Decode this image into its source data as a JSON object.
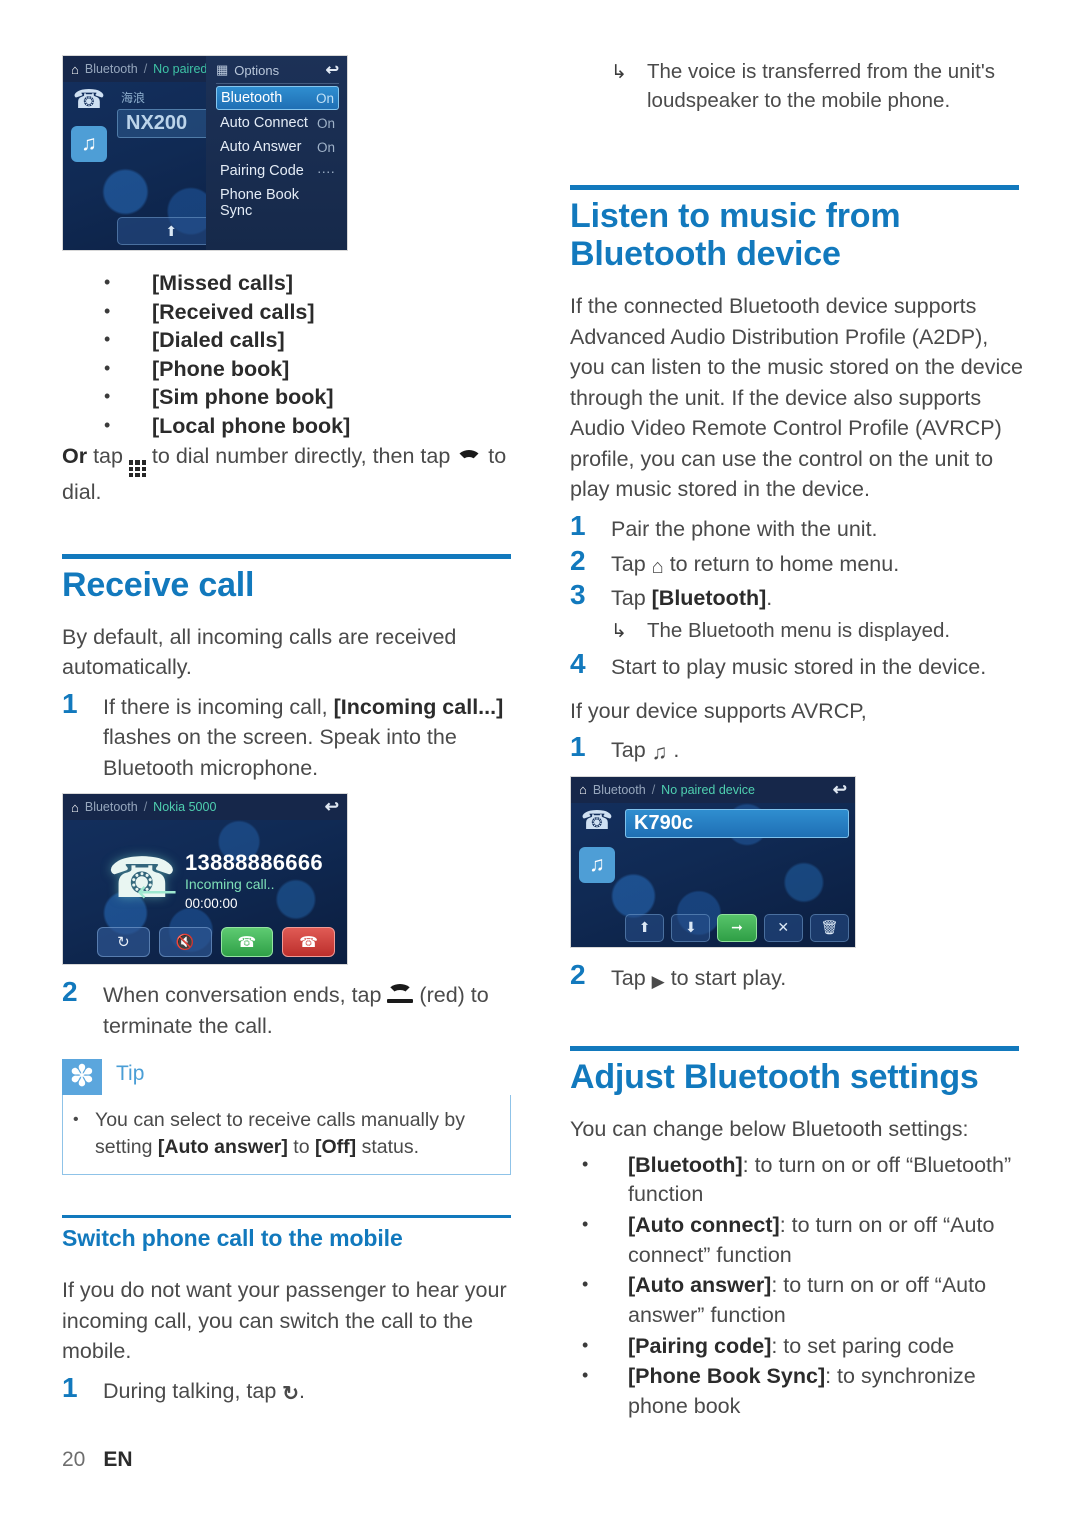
{
  "colors": {
    "heading_blue": "#1279bd",
    "tip_blue": "#5ba6dd",
    "body_gray": "#4a4a4a"
  },
  "footer": {
    "page_number": "20",
    "language": "EN"
  },
  "left_column": {
    "screenshot_options": {
      "breadcrumb_home_icon": "home-icon",
      "breadcrumb_first": "Bluetooth",
      "breadcrumb_sep": "/",
      "breadcrumb_second": "No paired device",
      "back_icon": "back-arrow-icon",
      "sidebar": {
        "phone_icon": "phone-icon",
        "music_icon": "music-note-icon"
      },
      "device_sub": "海浪",
      "device_name": "NX200",
      "options_panel": {
        "title": "Options",
        "menu_icon": "menu-grid-icon",
        "back_icon": "back-arrow-icon",
        "rows": [
          {
            "label": "Bluetooth",
            "value": "On",
            "selected": true
          },
          {
            "label": "Auto Connect",
            "value": "On",
            "selected": false
          },
          {
            "label": "Auto Answer",
            "value": "On",
            "selected": false
          },
          {
            "label": "Pairing Code",
            "value": "····",
            "selected": false
          },
          {
            "label": "Phone Book Sync",
            "value": "",
            "selected": false
          }
        ]
      },
      "nav_buttons": [
        "up-arrow-icon",
        "down-arrow-icon"
      ]
    },
    "call_list_bullets": [
      "[Missed calls]",
      "[Received calls]",
      "[Dialed calls]",
      "[Phone book]",
      "[Sim phone book]",
      "[Local phone book]"
    ],
    "or_tap": {
      "lead_bold": "Or",
      "part1": " tap ",
      "keypad_icon": "keypad-icon",
      "part2": " to dial number directly, then tap ",
      "handset_icon": "handset-off-hook-icon",
      "part3": " to dial."
    },
    "receive_call": {
      "heading": "Receive call",
      "intro": " By default, all incoming calls are received automatically.",
      "step1": {
        "num": "1",
        "pre": "If there is incoming call, ",
        "bold": "[Incoming call...]",
        "post": " flashes on the screen. Speak into the Bluetooth microphone."
      },
      "screenshot_incoming": {
        "breadcrumb_home_icon": "home-icon",
        "breadcrumb_first": "Bluetooth",
        "breadcrumb_sep": "/",
        "breadcrumb_second": "Nokia 5000",
        "back_icon": "back-arrow-icon",
        "phone_icon": "phone-incoming-icon",
        "arrow_icon": "left-arrow-icon",
        "number": "13888886666",
        "status": "Incoming call..",
        "timer": "00:00:00",
        "buttons": [
          "switch-icon",
          "mute-icon",
          "answer-icon",
          "hangup-icon"
        ]
      },
      "step2": {
        "num": "2",
        "pre": "When conversation ends, tap ",
        "icon": "handset-on-hook-icon",
        "post": " (red) to terminate the call."
      },
      "tip": {
        "icon": "asterisk-icon",
        "label": "Tip",
        "bullet_pre": "You can select to receive calls manually by setting ",
        "bullet_bold1": "[Auto answer]",
        "bullet_mid": " to ",
        "bullet_bold2": "[Off]",
        "bullet_post": " status."
      }
    },
    "switch_call": {
      "heading": "Switch phone call to the mobile",
      "body": "If you do not want your passenger to hear your incoming call, you can switch the call to the mobile.",
      "step1": {
        "num": "1",
        "pre": "During talking, tap ",
        "icon": "switch-audio-icon",
        "post": "."
      }
    }
  },
  "right_column": {
    "top_result": {
      "arrow_icon": "result-arrow-icon",
      "text": "The voice is transferred from the unit's loudspeaker to the mobile phone."
    },
    "listen_music": {
      "heading": "Listen to music from Bluetooth device",
      "intro": "If the connected Bluetooth device supports Advanced Audio Distribution Profile (A2DP), you can listen to the music stored on the device through the unit. If the device also supports Audio Video Remote Control Profile (AVRCP) profile, you can use the control on the unit to play music stored in the device.",
      "steps": [
        {
          "num": "1",
          "text": "Pair the phone with the unit."
        },
        {
          "num": "2",
          "pre": "Tap ",
          "icon": "home-icon",
          "post": " to return to home menu."
        },
        {
          "num": "3",
          "pre": "Tap ",
          "bold": "[Bluetooth]",
          "post": "."
        },
        {
          "num": "4",
          "text": "Start to play music stored in the device."
        }
      ],
      "step3_result": {
        "arrow_icon": "result-arrow-icon",
        "text": "The Bluetooth menu is displayed."
      },
      "avrcp_heading": "If your device supports AVRCP,",
      "avrcp_step1": {
        "num": "1",
        "pre": "Tap ",
        "icon": "music-note-icon",
        "post": " ."
      },
      "screenshot_avrcp": {
        "breadcrumb_home_icon": "home-icon",
        "breadcrumb_first": "Bluetooth",
        "breadcrumb_sep": "/",
        "breadcrumb_second": "No paired device",
        "back_icon": "back-arrow-icon",
        "phone_icon": "phone-icon",
        "music_icon": "music-note-icon",
        "device_name": "K790c",
        "buttons": [
          "up-arrow-icon",
          "down-arrow-icon",
          "connect-icon",
          "disconnect-icon",
          "delete-icon"
        ]
      },
      "avrcp_step2": {
        "num": "2",
        "pre": "Tap ",
        "icon": "play-icon",
        "post": " to start play."
      }
    },
    "adjust_settings": {
      "heading": "Adjust Bluetooth settings",
      "intro": "You can change below Bluetooth settings:",
      "items": [
        {
          "bold": "[Bluetooth]",
          "rest": ": to turn on or off “Bluetooth” function"
        },
        {
          "bold": "[Auto connect]",
          "rest": ": to turn on or off “Auto connect” function"
        },
        {
          "bold": "[Auto answer]",
          "rest": ": to turn on or off “Auto answer” function"
        },
        {
          "bold": "[Pairing code]",
          "rest": ": to set paring code"
        },
        {
          "bold": "[Phone Book Sync]",
          "rest": ": to synchronize phone book"
        }
      ]
    }
  }
}
